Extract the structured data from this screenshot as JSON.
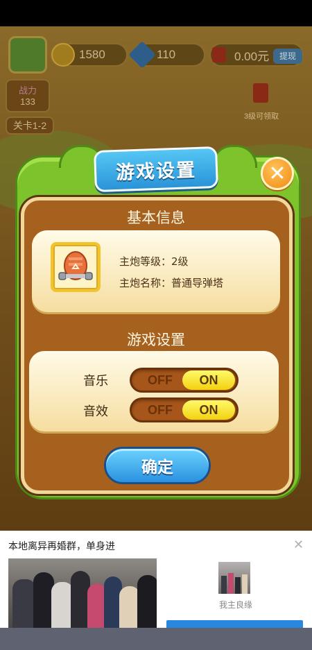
{
  "hud": {
    "coins": "1580",
    "gems": "110",
    "cash": "0.00元",
    "withdraw_label": "提现",
    "power_label": "战力",
    "power_value": "133",
    "level_label": "关卡1-2",
    "redpack_text": "3级可领取"
  },
  "dialog": {
    "title": "游戏设置",
    "basic_info_title": "基本信息",
    "cannon_level": "主炮等级：2级",
    "cannon_name": "主炮名称：普通导弹塔",
    "settings_title": "游戏设置",
    "music_label": "音乐",
    "sound_label": "音效",
    "off_label": "OFF",
    "on_label": "ON",
    "music_state": "on",
    "sound_state": "on",
    "confirm_label": "确定",
    "close_glyph": "✕"
  },
  "ad": {
    "title": "本地离异再婚群，单身进",
    "brand": "我主良缘",
    "close_glyph": "✕"
  },
  "colors": {
    "accent_green": "#7cc32c",
    "panel_brown": "#a6611f",
    "title_blue": "#2a94d8",
    "close_orange": "#f08a12",
    "toggle_yellow": "#f2d210"
  }
}
